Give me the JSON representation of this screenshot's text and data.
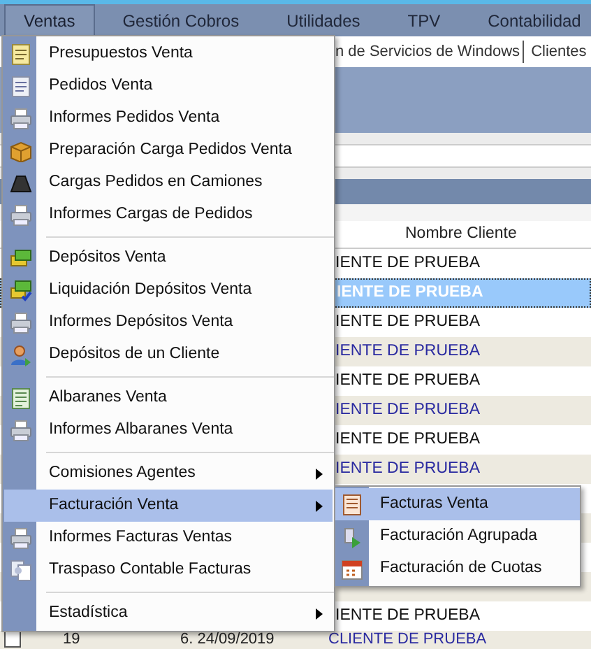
{
  "menubar": [
    {
      "label": "Ventas",
      "selected": true
    },
    {
      "label": "Gestión Cobros",
      "selected": false
    },
    {
      "label": "Utilidades",
      "selected": false
    },
    {
      "label": "TPV",
      "selected": false
    },
    {
      "label": "Contabilidad",
      "selected": false
    }
  ],
  "toolbar": {
    "tabs": [
      "n de Servicios de Windows",
      "Clientes"
    ]
  },
  "grid": {
    "columns": [
      "Nombre Cliente"
    ],
    "rows": [
      {
        "name": "IENTE DE PRUEBA",
        "selected": false,
        "kind": "plain"
      },
      {
        "name": "IENTE DE PRUEBA",
        "selected": true
      },
      {
        "name": "IENTE DE PRUEBA",
        "selected": false,
        "kind": "plain"
      },
      {
        "name": "IENTE DE PRUEBA",
        "selected": false,
        "kind": "shaded"
      },
      {
        "name": "IENTE DE PRUEBA",
        "selected": false,
        "kind": "plain"
      },
      {
        "name": "IENTE DE PRUEBA",
        "selected": false,
        "kind": "shaded"
      },
      {
        "name": "IENTE DE PRUEBA",
        "selected": false,
        "kind": "plain"
      },
      {
        "name": "IENTE DE PRUEBA",
        "selected": false,
        "kind": "shaded"
      },
      {
        "selected": false,
        "kind": "plain"
      },
      {
        "selected": false,
        "kind": "shaded"
      },
      {
        "selected": false,
        "kind": "plain"
      },
      {
        "selected": false,
        "kind": "shaded"
      },
      {
        "name": "IENTE DE PRUEBA",
        "selected": false,
        "kind": "plain"
      },
      {
        "checked": false,
        "number": "19",
        "date": "6. 24/09/2019",
        "name": "CLIENTE DE PRUEBA",
        "selected": false,
        "kind": "shaded"
      }
    ]
  },
  "menu": [
    {
      "kind": "item",
      "label": "Presupuestos Venta",
      "selected": false,
      "submenu": false
    },
    {
      "kind": "item",
      "label": "Pedidos Venta",
      "selected": false,
      "submenu": false
    },
    {
      "kind": "item",
      "label": "Informes Pedidos Venta",
      "selected": false,
      "submenu": false
    },
    {
      "kind": "item",
      "label": "Preparación Carga Pedidos Venta",
      "selected": false,
      "submenu": false
    },
    {
      "kind": "item",
      "label": "Cargas Pedidos en Camiones",
      "selected": false,
      "submenu": false
    },
    {
      "kind": "item",
      "label": "Informes Cargas de Pedidos",
      "selected": false,
      "submenu": false
    },
    {
      "kind": "separator"
    },
    {
      "kind": "item",
      "label": "Depósitos Venta",
      "selected": false,
      "submenu": false
    },
    {
      "kind": "item",
      "label": "Liquidación Depósitos Venta",
      "selected": false,
      "submenu": false
    },
    {
      "kind": "item",
      "label": "Informes Depósitos Venta",
      "selected": false,
      "submenu": false
    },
    {
      "kind": "item",
      "label": "Depósitos de un Cliente",
      "selected": false,
      "submenu": false
    },
    {
      "kind": "separator"
    },
    {
      "kind": "item",
      "label": "Albaranes Venta",
      "selected": false,
      "submenu": false
    },
    {
      "kind": "item",
      "label": "Informes Albaranes Venta",
      "selected": false,
      "submenu": false
    },
    {
      "kind": "separator"
    },
    {
      "kind": "item",
      "label": "Comisiones Agentes",
      "selected": false,
      "submenu": true
    },
    {
      "kind": "item",
      "label": "Facturación Venta",
      "selected": true,
      "submenu": true
    },
    {
      "kind": "item",
      "label": "Informes Facturas Ventas",
      "selected": false,
      "submenu": false
    },
    {
      "kind": "item",
      "label": "Traspaso Contable Facturas",
      "selected": false,
      "submenu": false
    },
    {
      "kind": "separator"
    },
    {
      "kind": "item",
      "label": "Estadística",
      "selected": false,
      "submenu": true
    }
  ],
  "submenu": [
    {
      "label": "Facturas Venta",
      "selected": true
    },
    {
      "label": "Facturación Agrupada",
      "selected": false
    },
    {
      "label": "Facturación de Cuotas",
      "selected": false
    }
  ]
}
